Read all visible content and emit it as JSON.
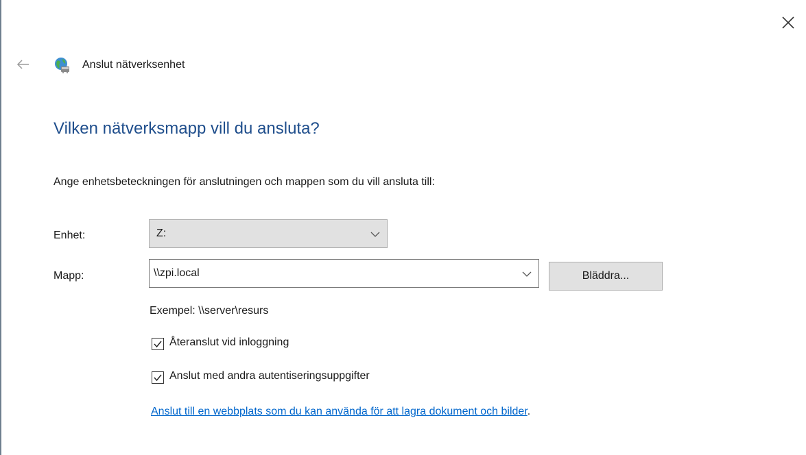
{
  "window": {
    "title": "Anslut nätverksenhet",
    "close_icon": "close-icon",
    "back_icon": "back-arrow-icon",
    "app_icon": "network-drive-globe-icon"
  },
  "page": {
    "heading": "Vilken nätverksmapp vill du ansluta?",
    "instruction": "Ange enhetsbeteckningen för anslutningen och mappen som du vill ansluta till:"
  },
  "form": {
    "drive_label": "Enhet:",
    "drive_value": "Z:",
    "folder_label": "Mapp:",
    "folder_value": "\\\\zpi.local",
    "browse_label": "Bläddra...",
    "example": "Exempel: \\\\server\\resurs",
    "reconnect_label": "Återanslut vid inloggning",
    "reconnect_checked": true,
    "credentials_label": "Anslut med andra autentiseringsuppgifter",
    "credentials_checked": true,
    "link_text": "Anslut till en webbplats som du kan använda för att lagra dokument och bilder",
    "link_suffix": "."
  },
  "colors": {
    "heading": "#1f4e8c",
    "link": "#0066cc",
    "button_bg": "#e1e1e1",
    "button_border": "#adadad",
    "window_edge": "#6f7f8f"
  }
}
